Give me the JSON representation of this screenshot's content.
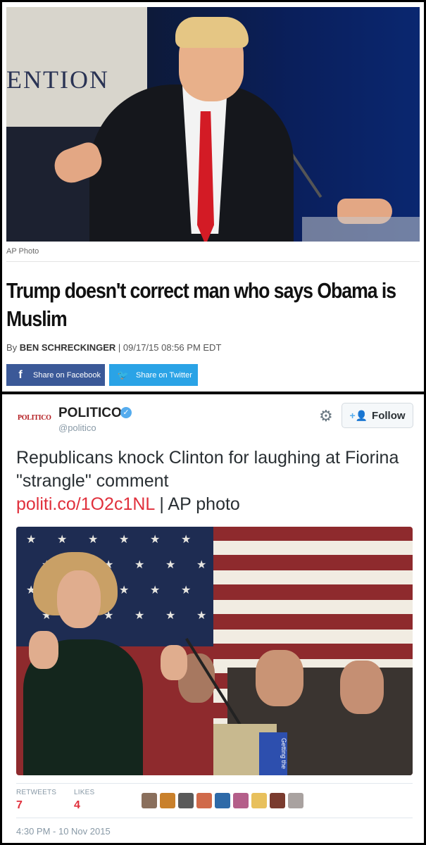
{
  "article": {
    "banner_text": "ENTION",
    "photo_credit": "AP Photo",
    "headline": "Trump doesn't correct man who says Obama is Muslim",
    "byline_prefix": "By ",
    "author": "BEN SCHRECKINGER",
    "date": " | 09/17/15 08:56 PM EDT",
    "share_facebook": "Share on Facebook",
    "share_twitter": "Share on Twitter",
    "facebook_icon": "f",
    "twitter_icon": "🐦"
  },
  "tweet": {
    "logo_text": "POLITICO",
    "account_name": "POLITICO",
    "handle": "@politico",
    "follow_label": "Follow",
    "text": "Republicans knock Clinton for laughing at Fiorina \"strangle\" comment",
    "link": "politi.co/1O2c1NL",
    "link_suffix": " | AP photo",
    "sign_text": "Getting the",
    "stats": {
      "retweets_label": "RETWEETS",
      "retweets": "7",
      "likes_label": "LIKES",
      "likes": "4"
    },
    "timestamp": "4:30 PM - 10 Nov 2015"
  },
  "colors": {
    "facebook": "#3b5998",
    "twitter": "#2aa3e6",
    "politico_red": "#e0303c",
    "verified_blue": "#55acee"
  },
  "avatar_colors": [
    "#8a6f5c",
    "#c9802b",
    "#5a5a5a",
    "#d06a4a",
    "#2e6aa8",
    "#b45f8a",
    "#e8c05c",
    "#7a3b2e",
    "#a9a2a0"
  ]
}
